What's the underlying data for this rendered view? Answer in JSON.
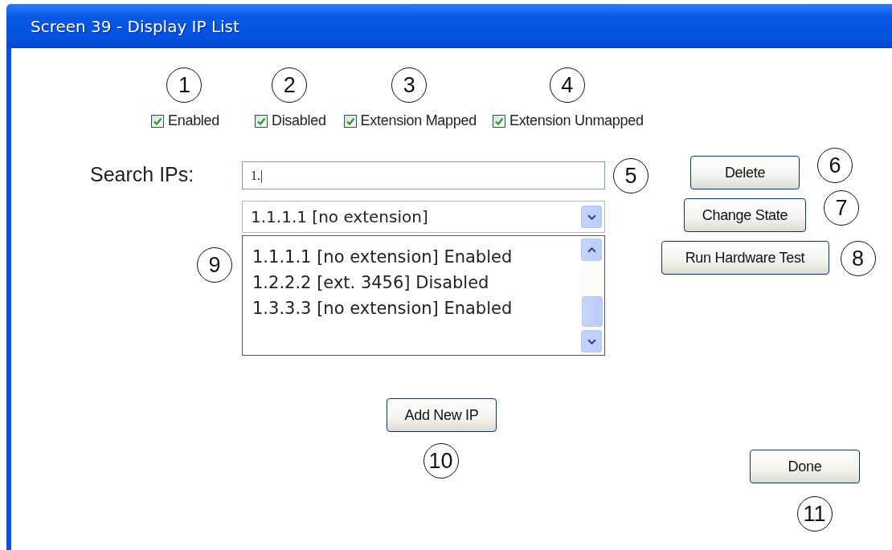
{
  "window": {
    "title": "Screen 39 - Display IP List"
  },
  "filters": [
    {
      "label": "Enabled",
      "checked": true,
      "callout": "1"
    },
    {
      "label": "Disabled",
      "checked": true,
      "callout": "2"
    },
    {
      "label": "Extension Mapped",
      "checked": true,
      "callout": "3"
    },
    {
      "label": "Extension Unmapped",
      "checked": true,
      "callout": "4"
    }
  ],
  "search": {
    "label": "Search IPs:",
    "value": "1.|",
    "callout": "5"
  },
  "ip_dropdown": {
    "value": "1.1.1.1 [no extension]"
  },
  "ip_list": {
    "callout": "9",
    "items": [
      "1.1.1.1 [no extension] Enabled",
      "1.2.2.2 [ext. 3456] Disabled",
      "1.3.3.3 [no extension] Enabled"
    ]
  },
  "actions": [
    {
      "label": "Delete",
      "callout": "6"
    },
    {
      "label": "Change State",
      "callout": "7"
    },
    {
      "label": "Run Hardware Test",
      "callout": "8"
    }
  ],
  "add_button": {
    "label": "Add New IP",
    "callout": "10"
  },
  "done_button": {
    "label": "Done",
    "callout": "11"
  }
}
